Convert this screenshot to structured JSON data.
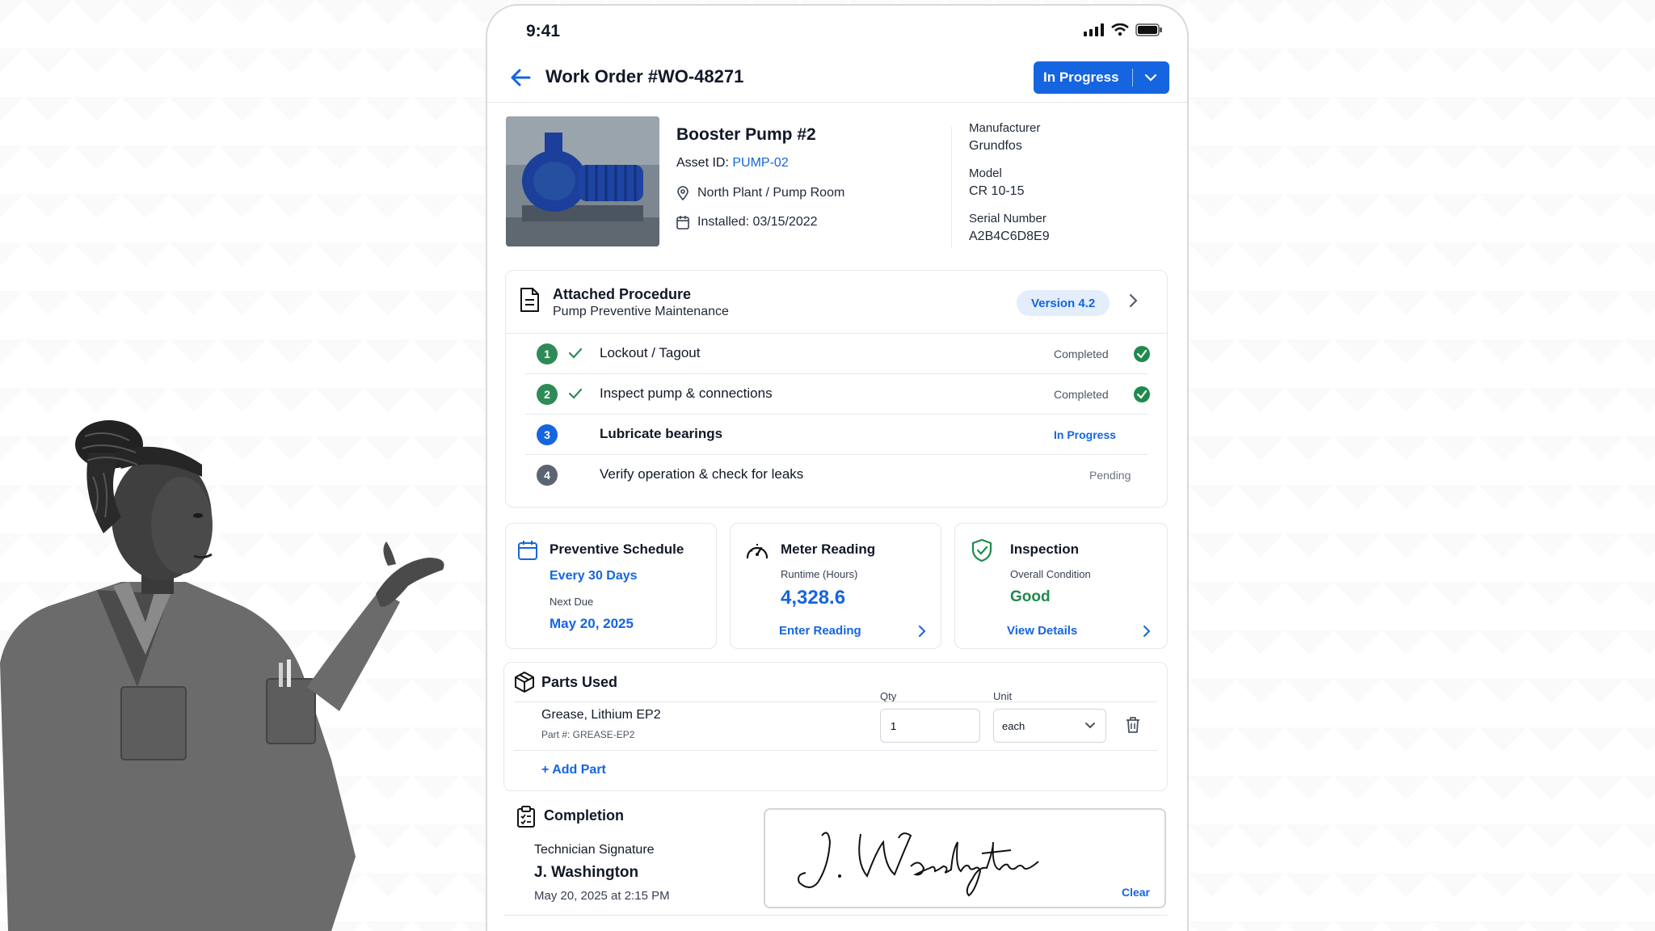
{
  "status_bar": {
    "time": "9:41"
  },
  "header": {
    "title": "Work Order #WO-48271",
    "status": "In Progress"
  },
  "asset": {
    "name": "Booster Pump #2",
    "id_label": "Asset ID:",
    "id_value": "PUMP-02",
    "location": "North Plant / Pump Room",
    "installed": "Installed: 03/15/2022",
    "manufacturer_label": "Manufacturer",
    "manufacturer": "Grundfos",
    "model_label": "Model",
    "model": "CR 10-15",
    "serial_label": "Serial Number",
    "serial": "A2B4C6D8E9"
  },
  "procedure": {
    "title": "Attached Procedure",
    "subtitle": "Pump Preventive Maintenance",
    "version": "Version 4.2",
    "steps": [
      {
        "num": "1",
        "label": "Lockout / Tagout",
        "status": "Completed"
      },
      {
        "num": "2",
        "label": "Inspect pump & connections",
        "status": "Completed"
      },
      {
        "num": "3",
        "label": "Lubricate bearings",
        "status": "In Progress"
      },
      {
        "num": "4",
        "label": "Verify operation & check for leaks",
        "status": "Pending"
      }
    ]
  },
  "schedule": {
    "title": "Preventive Schedule",
    "frequency": "Every 30 Days",
    "next_label": "Next Due",
    "next_date": "May 20, 2025"
  },
  "meter": {
    "title": "Meter Reading",
    "label": "Runtime (Hours)",
    "value": "4,328.6",
    "action": "Enter Reading"
  },
  "inspection": {
    "title": "Inspection",
    "label": "Overall Condition",
    "value": "Good",
    "action": "View Details"
  },
  "parts": {
    "title": "Parts Used",
    "qty_header": "Qty",
    "unit_header": "Unit",
    "items": [
      {
        "name": "Grease, Lithium EP2",
        "part_no": "Part #: GREASE-EP2",
        "qty": "1",
        "unit": "each"
      }
    ],
    "add_label": "+ Add Part"
  },
  "completion": {
    "title": "Completion",
    "signature_label": "Technician Signature",
    "technician": "J. Washington",
    "signed_at": "May 20, 2025 at 2:15 PM",
    "signature_script": "J. Washington",
    "clear_label": "Clear"
  },
  "colors": {
    "primary": "#1565e0",
    "success": "#1f8a4c",
    "step_done": "#2e8b57",
    "step_pending": "#5b6472"
  }
}
